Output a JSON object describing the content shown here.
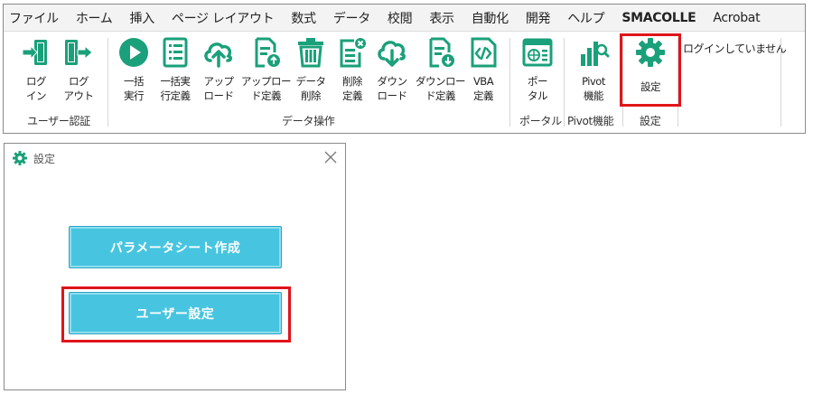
{
  "menubar": {
    "items": [
      "ファイル",
      "ホーム",
      "挿入",
      "ページ レイアウト",
      "数式",
      "データ",
      "校閲",
      "表示",
      "自動化",
      "開発",
      "ヘルプ",
      "SMACOLLE",
      "Acrobat"
    ],
    "active": "SMACOLLE"
  },
  "ribbon": {
    "buttons": {
      "login": "ログ\nイン",
      "logout": "ログ\nアウト",
      "batch_run": "一括\n実行",
      "batch_def": "一括実\n行定義",
      "upload": "アップ\nロード",
      "upload_def": "アップロー\nド定義",
      "data_delete": "データ\n削除",
      "delete_def": "削除\n定義",
      "download": "ダウン\nロード",
      "download_def": "ダウンロー\nド定義",
      "vba_def": "VBA\n定義",
      "portal": "ポー\nタル",
      "pivot": "Pivot\n機能",
      "settings": "設定"
    },
    "groups": {
      "user_auth": "ユーザー認証",
      "data_ops": "データ操作",
      "portal": "ポータル",
      "pivot": "Pivot機能",
      "settings": "設定"
    },
    "login_status": "ログインしていません"
  },
  "dialog": {
    "title": "設定",
    "buttons": {
      "param_sheet": "パラメータシート作成",
      "user_settings": "ユーザー設定"
    }
  },
  "colors": {
    "icon_green": "#1aa07a",
    "dialog_button": "#47c5e0",
    "highlight": "#e0141a"
  }
}
